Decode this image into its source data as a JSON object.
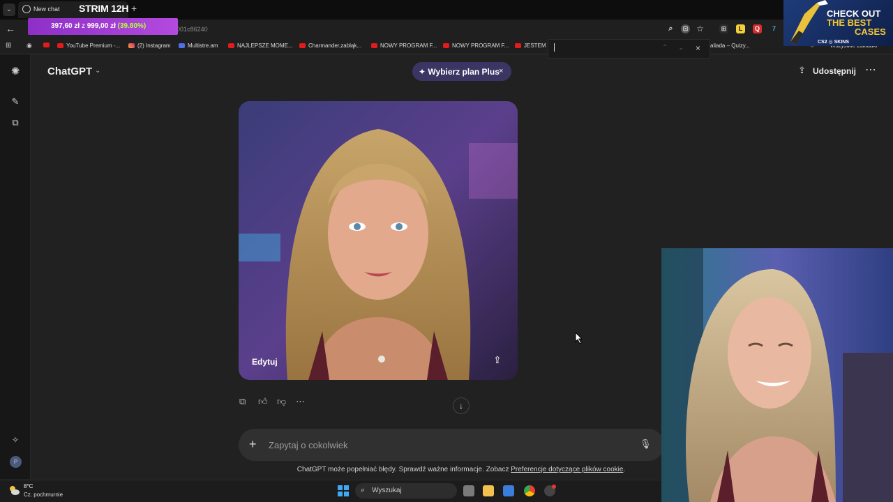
{
  "browser": {
    "tab_title": "New chat",
    "stream_title": "STRIM 12H",
    "new_tab_glyph": "+",
    "url": "…-832d-bb46-86e001c86240",
    "donation": {
      "amount": "397,60 zł",
      "of": "z",
      "goal": "999,00 zł",
      "percent": "(39.80%)",
      "progress": 0.398
    },
    "bookmarks": [
      "YouTube Premium -...",
      "(2) Instagram",
      "Multistre.am",
      "NAJLEPSZE MOME...",
      "Charmander,zabląk...",
      "NOWY PROGRAM F...",
      "NOWY PROGRAM F...",
      "JESTEM D",
      "aliada – Quizy...",
      "Wszystkie zakładki"
    ]
  },
  "ad": {
    "line1": "CHECK OUT",
    "line2": "THE BEST",
    "line3": "CASES",
    "brand": "CS2 ◎ SKINS"
  },
  "app": {
    "title": "ChatGPT",
    "plus_pill": "Wybierz plan Plus",
    "plus_close": "×",
    "share": "Udostępnij",
    "image_edit": "Edytuj",
    "composer_placeholder": "Zapytaj o cokolwiek",
    "footer_prefix": "ChatGPT może popełniać błędy. Sprawdź ważne informacje. Zobacz ",
    "footer_link": "Preferencje dotyczące plików cookie",
    "footer_suffix": ".",
    "avatar_initial": "P"
  },
  "taskbar": {
    "temp": "8°C",
    "desc": "Cz. pochmurnie",
    "search": "Wyszukaj"
  },
  "colors": {
    "accent_plus": "#3b3563",
    "donation": "#b44adf",
    "brand_ad": "#f6c932"
  }
}
